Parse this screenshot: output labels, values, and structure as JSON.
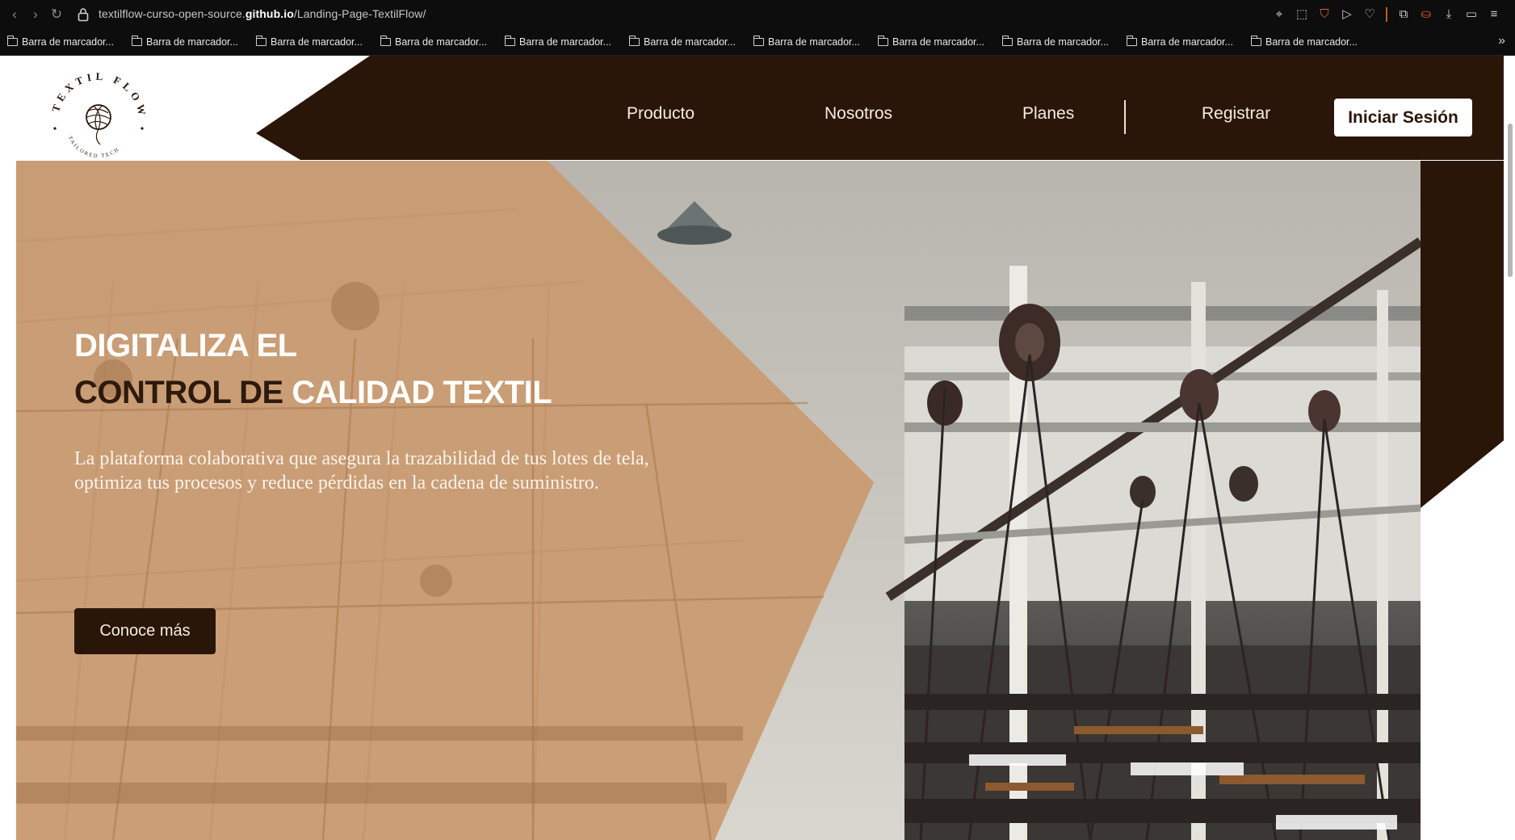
{
  "browser": {
    "url_prefix": "textilflow-curso-open-source.",
    "url_domain": "github.io",
    "url_path": "/Landing-Page-TextilFlow/",
    "bookmarks": [
      "Barra de marcador...",
      "Barra de marcador...",
      "Barra de marcador...",
      "Barra de marcador...",
      "Barra de marcador...",
      "Barra de marcador...",
      "Barra de marcador...",
      "Barra de marcador...",
      "Barra de marcador...",
      "Barra de marcador...",
      "Barra de marcador..."
    ],
    "extension_icons": [
      "pin-icon",
      "screenshot-icon",
      "shield-icon",
      "play-icon",
      "heart-icon",
      "puzzle-icon",
      "account-icon",
      "download-icon",
      "battery-icon",
      "menu-icon"
    ]
  },
  "logo": {
    "name": "TEXTIL FLOW",
    "tagline": "TAILORED TECH"
  },
  "nav": {
    "items": [
      "Producto",
      "Nosotros",
      "Planes",
      "Registrar"
    ],
    "login": "Iniciar Sesión"
  },
  "hero": {
    "line1": "DIGITALIZA EL",
    "line2_dark": "CONTROL DE ",
    "line2_light": "CALIDAD TEXTIL",
    "subtitle": "La plataforma colaborativa que asegura la trazabilidad de tus lotes de tela, optimiza tus procesos y reduce pérdidas en la cadena de suministro.",
    "cta": "Conoce más"
  },
  "colors": {
    "header_brown": "#2a1608",
    "overlay_tan": "#c99a70",
    "text_light": "#f4ede4"
  }
}
